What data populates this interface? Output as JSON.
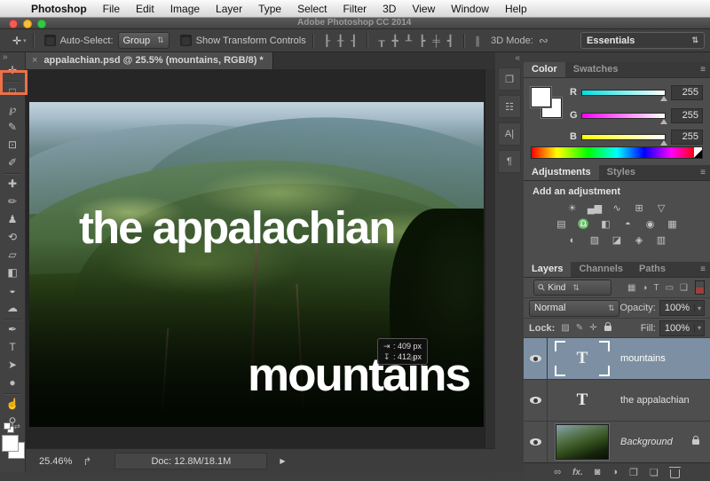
{
  "menubar": {
    "items": [
      "Photoshop",
      "File",
      "Edit",
      "Image",
      "Layer",
      "Type",
      "Select",
      "Filter",
      "3D",
      "View",
      "Window",
      "Help"
    ],
    "apple_icon": ""
  },
  "titlebar": {
    "title": "Adobe Photoshop CC 2014"
  },
  "ui": {
    "stepper": "⇅",
    "dropdown_arrow": "▾",
    "panel_menu": "≡",
    "tool_dd_arrow": "▾"
  },
  "options": {
    "move_tool_icon": "✛",
    "auto_select": "Auto-Select:",
    "group": "Group",
    "show_transform": "Show Transform Controls",
    "mode_label": "3D Mode:",
    "orbit_icon": "∾",
    "workspace": "Essentials",
    "align_icons": [
      {
        "name": "align-left-edges",
        "glyph": "┠"
      },
      {
        "name": "align-horizontal-centers",
        "glyph": "╂"
      },
      {
        "name": "align-right-edges",
        "glyph": "┨"
      },
      {
        "name": "align-top-edges",
        "glyph": "┰"
      },
      {
        "name": "align-vertical-centers",
        "glyph": "╋"
      },
      {
        "name": "align-bottom-edges",
        "glyph": "┸"
      },
      {
        "name": "distribute-left-edges",
        "glyph": "┣"
      },
      {
        "name": "distribute-horizontal-centers",
        "glyph": "╪"
      },
      {
        "name": "distribute-right-edges",
        "glyph": "┫"
      },
      {
        "name": "distribute-spacing",
        "glyph": "∥"
      }
    ]
  },
  "tab": {
    "close": "×",
    "title": "appalachian.psd @ 25.5% (mountains, RGB/8) *"
  },
  "toolbar": {
    "collapse": "»",
    "tools": [
      {
        "name": "move-tool",
        "glyph": "✛"
      },
      {
        "name": "marquee-tool",
        "glyph": "□"
      },
      {
        "name": "lasso-tool",
        "glyph": "℘"
      },
      {
        "name": "quick-selection-tool",
        "glyph": "✎"
      },
      {
        "name": "crop-tool",
        "glyph": "⊡"
      },
      {
        "name": "eyedropper-tool",
        "glyph": "✐"
      },
      {
        "name": "healing-brush-tool",
        "glyph": "✚"
      },
      {
        "name": "brush-tool",
        "glyph": "✏"
      },
      {
        "name": "clone-stamp-tool",
        "glyph": "♟"
      },
      {
        "name": "history-brush-tool",
        "glyph": "⟲"
      },
      {
        "name": "eraser-tool",
        "glyph": "▱"
      },
      {
        "name": "gradient-tool",
        "glyph": "◧"
      },
      {
        "name": "smudge-tool",
        "glyph": "◒"
      },
      {
        "name": "blur-tool",
        "glyph": "☁"
      },
      {
        "name": "pen-tool",
        "glyph": "✒"
      },
      {
        "name": "type-tool",
        "glyph": "T"
      },
      {
        "name": "path-selection-tool",
        "glyph": "➤"
      },
      {
        "name": "ellipse-tool",
        "glyph": "●"
      },
      {
        "name": "hand-tool",
        "glyph": "☝"
      },
      {
        "name": "zoom-tool",
        "glyph": "⚲"
      }
    ]
  },
  "canvas": {
    "title_text": "the appalachian",
    "subtitle_text": "mountains",
    "tooltip": {
      "w_icon": "⇥",
      "w": ": 409 px",
      "h_icon": "↧",
      "h": ": 412 px"
    }
  },
  "panel_strip": {
    "collapse": "«",
    "icons": [
      {
        "name": "history-panel",
        "glyph": "❐"
      },
      {
        "name": "properties-panel",
        "glyph": "☷"
      },
      {
        "name": "character-panel",
        "glyph": "A|"
      },
      {
        "name": "paragraph-panel",
        "glyph": "¶"
      }
    ]
  },
  "color_panel": {
    "tabs": {
      "color": "Color",
      "swatches": "Swatches"
    },
    "sliders": [
      {
        "label": "R",
        "value": "255"
      },
      {
        "label": "G",
        "value": "255"
      },
      {
        "label": "B",
        "value": "255"
      }
    ]
  },
  "adjustments_panel": {
    "tabs": {
      "adjustments": "Adjustments",
      "styles": "Styles"
    },
    "heading": "Add an adjustment",
    "icons": [
      {
        "name": "brightness-contrast",
        "glyph": "☀"
      },
      {
        "name": "levels",
        "glyph": "▄▆"
      },
      {
        "name": "curves",
        "glyph": "∿"
      },
      {
        "name": "exposure",
        "glyph": "⊞"
      },
      {
        "name": "vibrance",
        "glyph": "▽"
      },
      {
        "name": "hue-saturation",
        "glyph": "▤"
      },
      {
        "name": "color-balance",
        "glyph": "♎"
      },
      {
        "name": "black-white",
        "glyph": "◧"
      },
      {
        "name": "photo-filter",
        "glyph": "◓"
      },
      {
        "name": "channel-mixer",
        "glyph": "◉"
      },
      {
        "name": "color-lookup",
        "glyph": "▦"
      },
      {
        "name": "invert",
        "glyph": "◐"
      },
      {
        "name": "posterize",
        "glyph": "▨"
      },
      {
        "name": "threshold",
        "glyph": "◪"
      },
      {
        "name": "selective-color",
        "glyph": "◈"
      },
      {
        "name": "gradient-map",
        "glyph": "▥"
      }
    ]
  },
  "layers_panel": {
    "tabs": {
      "layers": "Layers",
      "channels": "Channels",
      "paths": "Paths"
    },
    "search_icon": "⚲",
    "kind": "Kind",
    "filter_icons": [
      {
        "name": "filter-pixel-layers",
        "glyph": "▦"
      },
      {
        "name": "filter-adjustment-layers",
        "glyph": "◑"
      },
      {
        "name": "filter-type-layers",
        "glyph": "T"
      },
      {
        "name": "filter-shape-layers",
        "glyph": "▭"
      },
      {
        "name": "filter-smart-objects",
        "glyph": "❏"
      }
    ],
    "blend_mode": "Normal",
    "opacity_label": "Opacity:",
    "opacity": "100%",
    "lock_label": "Lock:",
    "lock_icons": [
      {
        "name": "lock-transparent-pixels",
        "glyph": "▨"
      },
      {
        "name": "lock-image-pixels",
        "glyph": "✎"
      },
      {
        "name": "lock-position",
        "glyph": "✛"
      }
    ],
    "fill_label": "Fill:",
    "fill": "100%",
    "type_thumb": "T",
    "rows": [
      {
        "name": "mountains"
      },
      {
        "name": "the appalachian"
      },
      {
        "name": "Background"
      }
    ],
    "bottom": {
      "link": "∞",
      "fx": "fx.",
      "mask": "◙",
      "adjustment": "◑",
      "folder": "❒",
      "new_layer": "❏"
    }
  },
  "statusbar": {
    "zoom": "25.46%",
    "share_icon": "↱",
    "doc": "Doc: 12.8M/18.1M",
    "arrow": "▶"
  }
}
